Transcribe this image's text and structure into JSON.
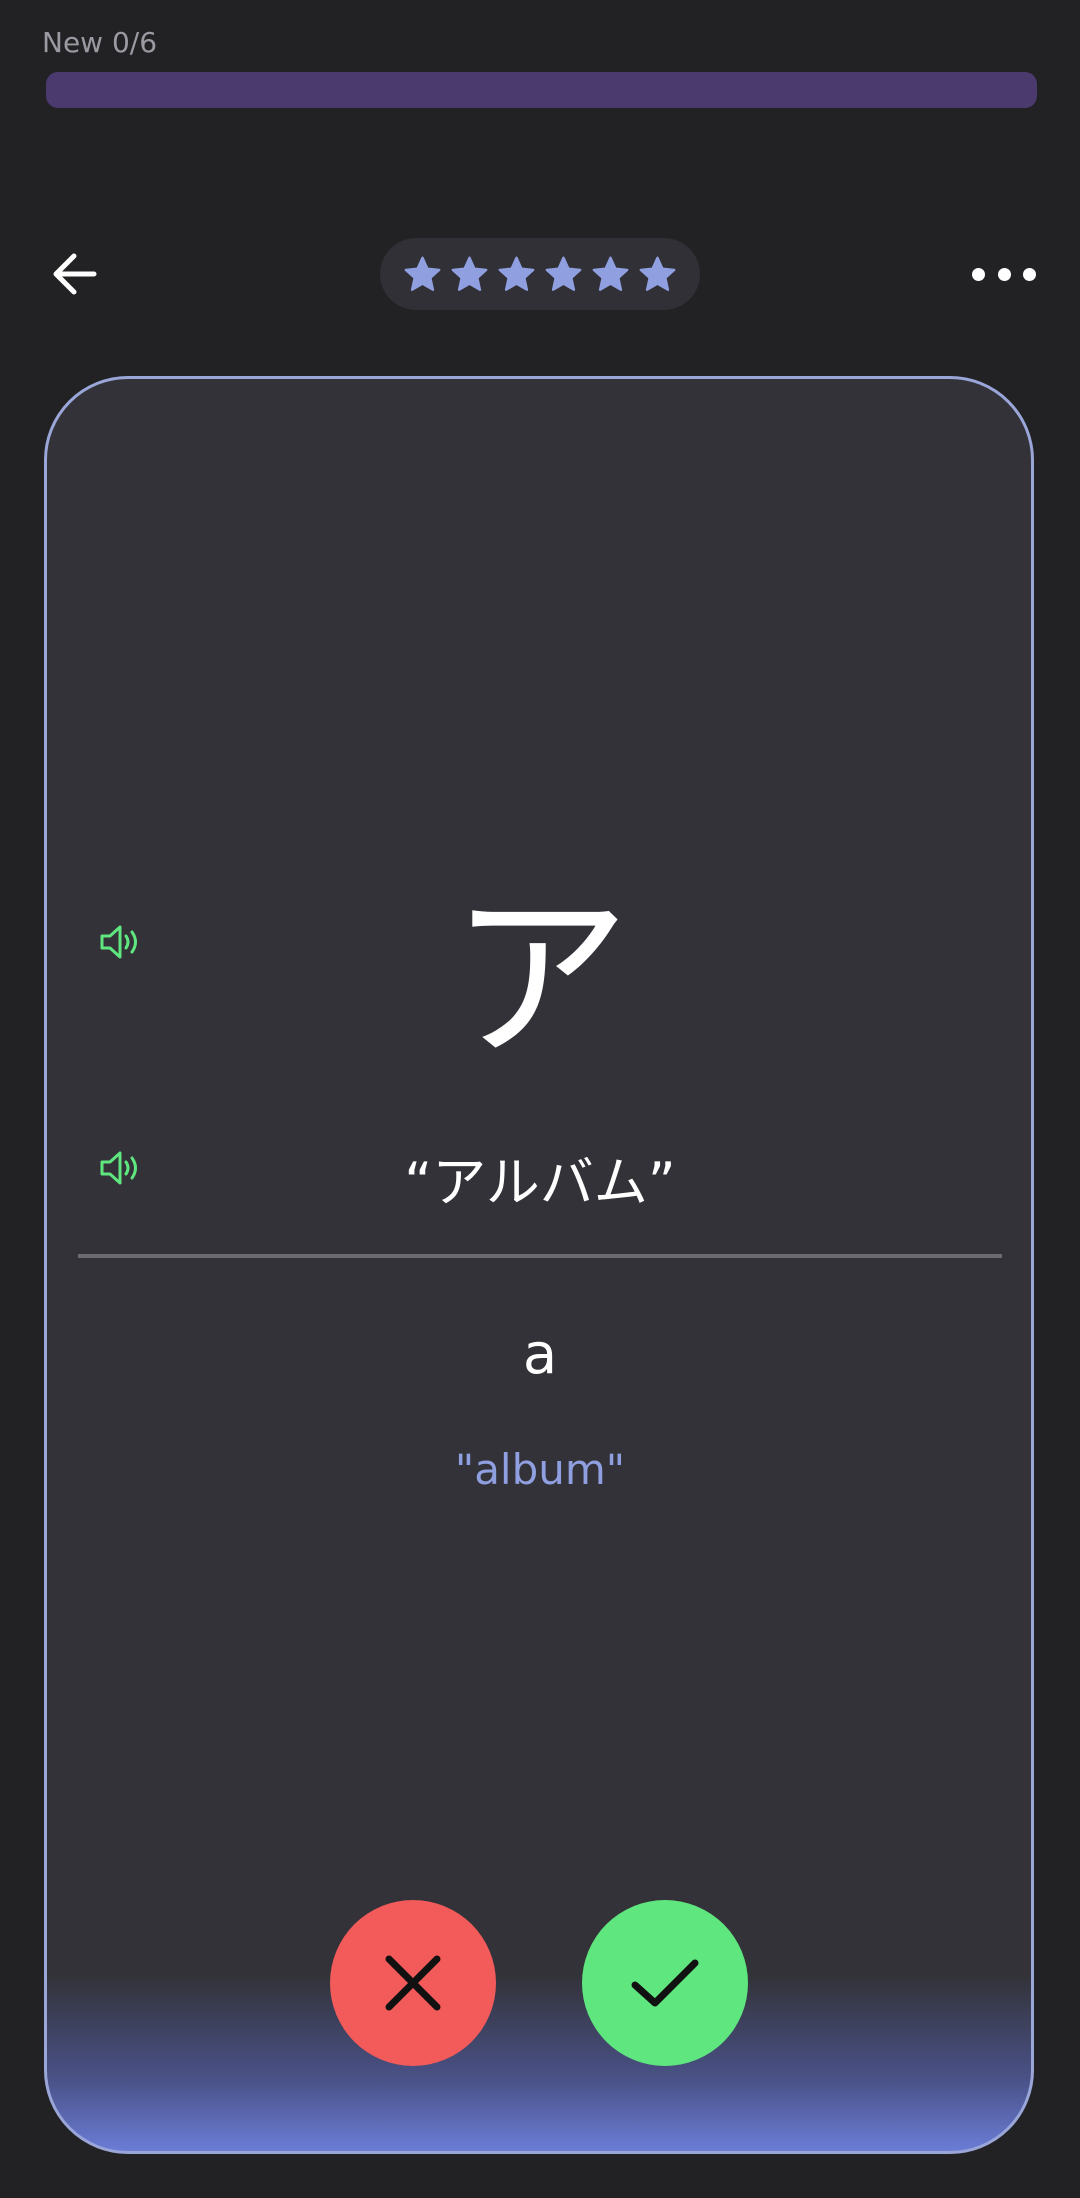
{
  "progress": {
    "label": "New 0/6",
    "value": 0,
    "track_color": "#4a3a6e"
  },
  "header": {
    "back_icon": "arrow-left-icon",
    "stars_count": 6,
    "star_color": "#8f9fe0",
    "more_icon": "more-horizontal-icon"
  },
  "card": {
    "kana": "ア",
    "example_word": "“アルバム”",
    "romaji": "a",
    "meaning": "\"album\"",
    "speaker_icon": "speaker-icon",
    "speaker_color": "#5fe67e",
    "border_color": "#9aa6d8"
  },
  "actions": {
    "wrong_icon": "close-icon",
    "wrong_color": "#f35a5a",
    "right_icon": "check-icon",
    "right_color": "#5fe67e"
  }
}
